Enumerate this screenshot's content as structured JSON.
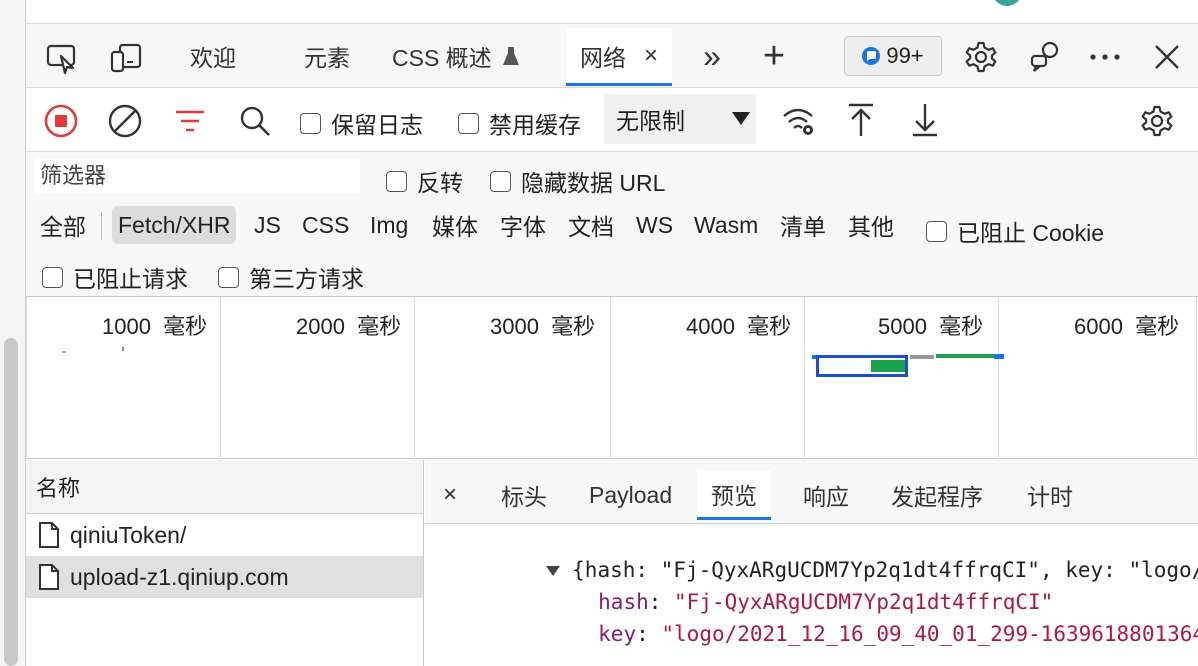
{
  "tabs": {
    "welcome": "欢迎",
    "elements": "元素",
    "css_overview": "CSS 概述",
    "network": "网络",
    "close": "×",
    "more_tabs": "»",
    "add": "+"
  },
  "issues_badge": "99+",
  "toolbar": {
    "preserve_log": "保留日志",
    "disable_cache": "禁用缓存",
    "throttling": "无限制"
  },
  "filter": {
    "placeholder": "筛选器",
    "invert": "反转",
    "hide_data_urls": "隐藏数据 URL",
    "types": [
      "全部",
      "Fetch/XHR",
      "JS",
      "CSS",
      "Img",
      "媒体",
      "字体",
      "文档",
      "WS",
      "Wasm",
      "清单",
      "其他"
    ],
    "selected_type": "Fetch/XHR",
    "blocked_cookies": "已阻止 Cookie",
    "blocked_requests": "已阻止请求",
    "third_party": "第三方请求"
  },
  "overview": {
    "ticks": [
      "1000  毫秒",
      "2000  毫秒",
      "3000  毫秒",
      "4000  毫秒",
      "5000  毫秒",
      "6000  毫秒"
    ]
  },
  "requests": {
    "header": "名称",
    "items": [
      {
        "name": "qiniuToken/",
        "selected": false
      },
      {
        "name": "upload-z1.qiniup.com",
        "selected": true
      }
    ]
  },
  "detail": {
    "close": "×",
    "tabs": [
      "标头",
      "Payload",
      "预览",
      "响应",
      "发起程序",
      "计时"
    ],
    "active_tab": "预览",
    "preview": {
      "summary": "{hash: \"Fj-QyxARgUCDM7Yp2q1dt4ffrqCI\", key: \"logo/",
      "hash_key": "hash",
      "hash_value": "\"Fj-QyxARgUCDM7Yp2q1dt4ffrqCI\"",
      "key_key": "key",
      "key_value": "\"logo/2021_12_16_09_40_01_299-1639618801364."
    }
  },
  "colors": {
    "accent": "#1a73e8",
    "record_red": "#e53935",
    "filter_red": "#e53935",
    "json_key": "#8e1a6e",
    "json_string": "#b0154a"
  }
}
